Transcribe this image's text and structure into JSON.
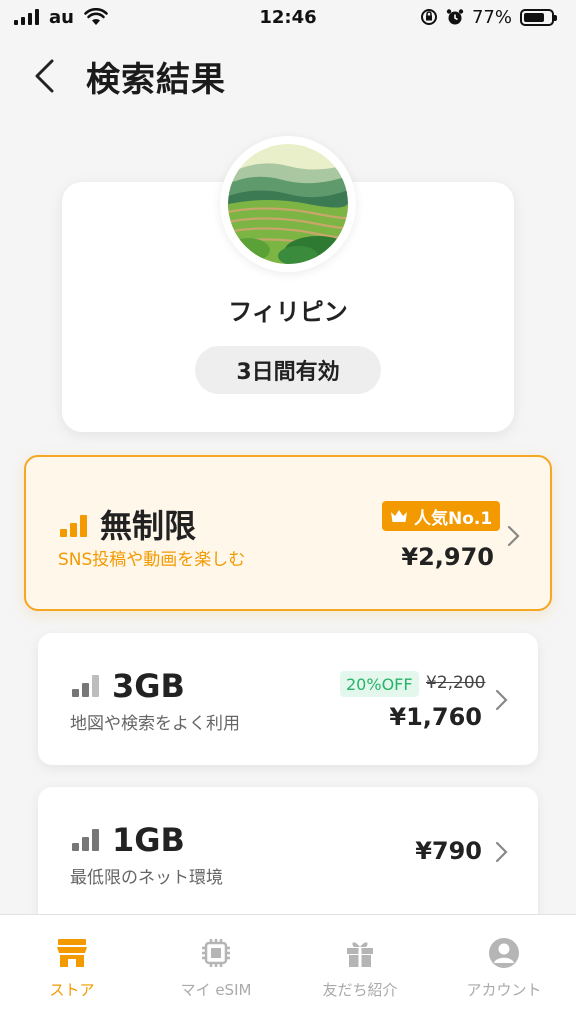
{
  "status_bar": {
    "carrier": "au",
    "time": "12:46",
    "battery": "77%",
    "battery_level": 0.77
  },
  "header": {
    "title": "検索結果"
  },
  "country": {
    "name": "フィリピン",
    "validity": "3日間有効"
  },
  "plans": [
    {
      "name": "無制限",
      "description": "SNS投稿や動画を楽しむ",
      "badge": "人気No.1",
      "price": "¥2,970"
    },
    {
      "name": "3GB",
      "description": "地図や検索をよく利用",
      "discount_badge": "20%OFF",
      "old_price": "¥2,200",
      "price": "¥1,760"
    },
    {
      "name": "1GB",
      "description": "最低限のネット環境",
      "price": "¥790"
    }
  ],
  "tabs": [
    {
      "label": "ストア",
      "icon": "store-icon",
      "active": true
    },
    {
      "label": "マイ eSIM",
      "icon": "chip-icon",
      "active": false
    },
    {
      "label": "友だち紹介",
      "icon": "gift-icon",
      "active": false
    },
    {
      "label": "アカウント",
      "icon": "account-icon",
      "active": false
    }
  ],
  "colors": {
    "accent": "#f29a00",
    "featured_bg": "#fff7ea",
    "discount_green": "#27b36a",
    "inactive": "#aaaaaa"
  }
}
